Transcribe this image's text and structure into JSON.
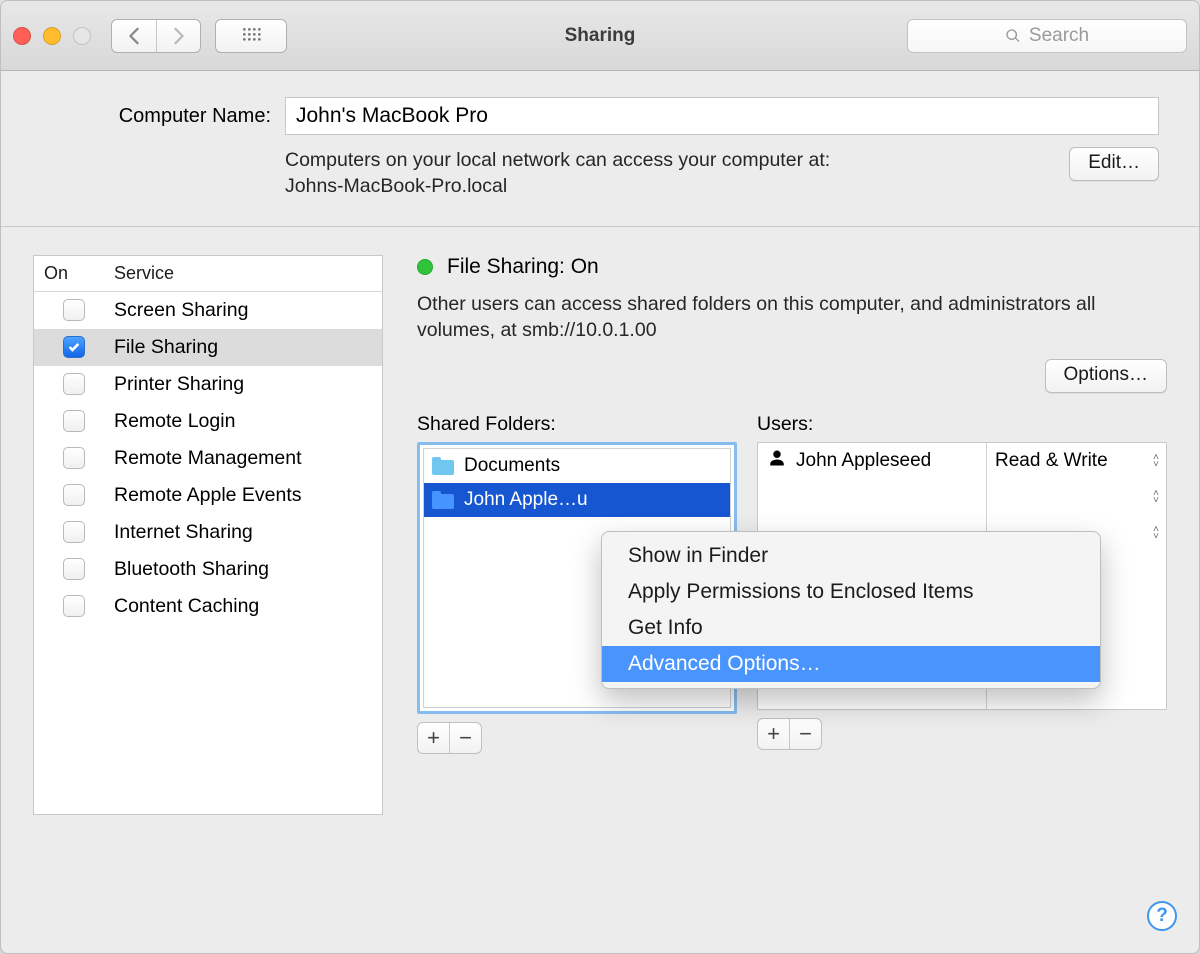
{
  "window": {
    "title": "Sharing"
  },
  "search": {
    "placeholder": "Search"
  },
  "name": {
    "label": "Computer Name:",
    "value": "John's MacBook Pro",
    "hint1": "Computers on your local network can access your computer at:",
    "hint2": "Johns-MacBook-Pro.local",
    "editLabel": "Edit…"
  },
  "services": {
    "headerOn": "On",
    "headerService": "Service",
    "items": [
      {
        "label": "Screen Sharing",
        "on": false
      },
      {
        "label": "File Sharing",
        "on": true
      },
      {
        "label": "Printer Sharing",
        "on": false
      },
      {
        "label": "Remote Login",
        "on": false
      },
      {
        "label": "Remote Management",
        "on": false
      },
      {
        "label": "Remote Apple Events",
        "on": false
      },
      {
        "label": "Internet Sharing",
        "on": false
      },
      {
        "label": "Bluetooth Sharing",
        "on": false
      },
      {
        "label": "Content Caching",
        "on": false
      }
    ],
    "selectedIndex": 1
  },
  "status": {
    "title": "File Sharing: On",
    "description": "Other users can access shared folders on this computer, and administrators all volumes, at smb://10.0.1.00",
    "optionsLabel": "Options…"
  },
  "folders": {
    "label": "Shared Folders:",
    "items": [
      {
        "name": "Documents"
      },
      {
        "name": "John Apple…u"
      }
    ],
    "selectedIndex": 1
  },
  "users": {
    "label": "Users:",
    "items": [
      {
        "name": "John Appleseed",
        "perm": "Read & Write"
      }
    ]
  },
  "context": {
    "items": [
      "Show in Finder",
      "Apply Permissions to Enclosed Items",
      "Get Info",
      "Advanced Options…"
    ],
    "highlightedIndex": 3
  },
  "buttons": {
    "plus": "+",
    "minus": "−"
  },
  "help": "?"
}
